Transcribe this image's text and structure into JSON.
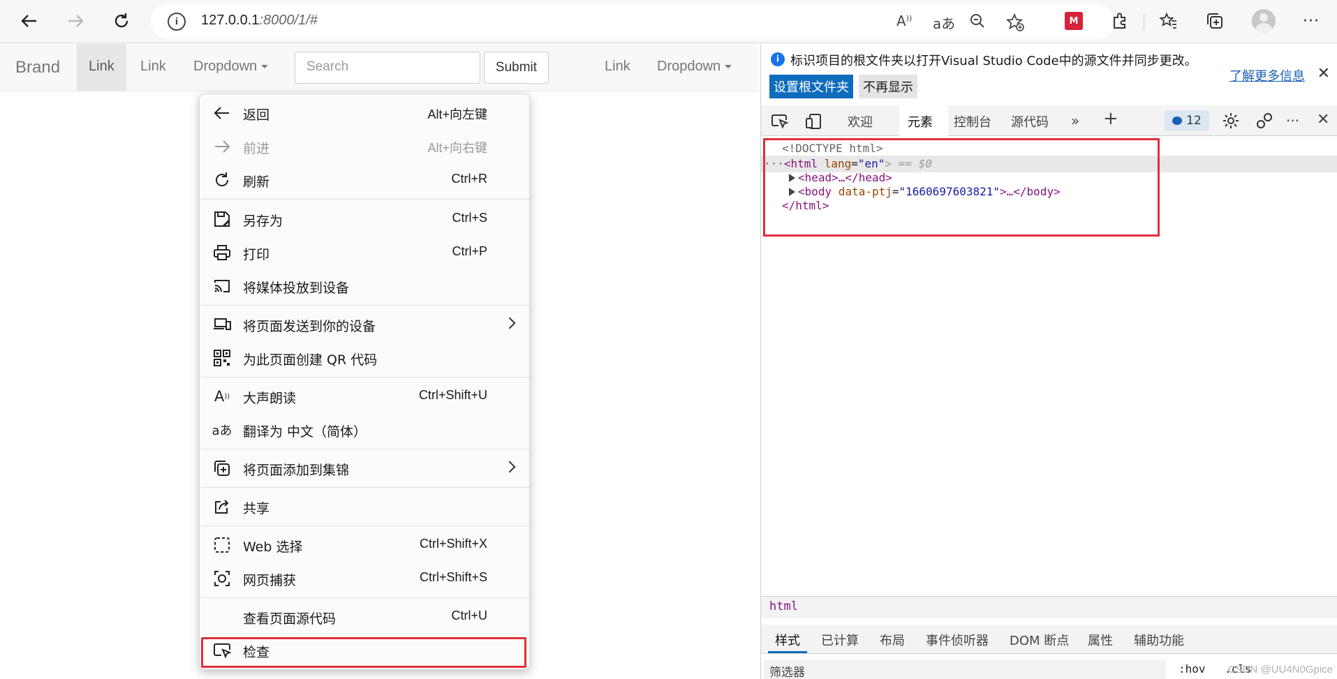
{
  "browser": {
    "url_host": "127.0.0.1",
    "url_rest": ":8000/1/#"
  },
  "navbar": {
    "brand": "Brand",
    "link_active": "Link",
    "link2": "Link",
    "dropdown": "Dropdown",
    "search_placeholder": "Search",
    "submit": "Submit",
    "link3": "Link",
    "dropdown2": "Dropdown"
  },
  "context_menu": {
    "items": [
      {
        "label": "返回",
        "shortcut": "Alt+向左键",
        "icon": "arrow-left-icon",
        "enabled": true
      },
      {
        "label": "前进",
        "shortcut": "Alt+向右键",
        "icon": "arrow-right-icon",
        "enabled": false
      },
      {
        "label": "刷新",
        "shortcut": "Ctrl+R",
        "icon": "refresh-icon",
        "enabled": true
      },
      {
        "label": "另存为",
        "shortcut": "Ctrl+S",
        "icon": "save-as-icon",
        "enabled": true
      },
      {
        "label": "打印",
        "shortcut": "Ctrl+P",
        "icon": "print-icon",
        "enabled": true
      },
      {
        "label": "将媒体投放到设备",
        "shortcut": "",
        "icon": "cast-icon",
        "enabled": true
      },
      {
        "label": "将页面发送到你的设备",
        "shortcut": "",
        "icon": "devices-icon",
        "enabled": true,
        "submenu": true
      },
      {
        "label": "为此页面创建 QR 代码",
        "shortcut": "",
        "icon": "qr-code-icon",
        "enabled": true
      },
      {
        "label": "大声朗读",
        "shortcut": "Ctrl+Shift+U",
        "icon": "read-aloud-icon",
        "enabled": true
      },
      {
        "label": "翻译为 中文（简体）",
        "shortcut": "",
        "icon": "translate-icon",
        "enabled": true
      },
      {
        "label": "将页面添加到集锦",
        "shortcut": "",
        "icon": "collections-icon",
        "enabled": true,
        "submenu": true
      },
      {
        "label": "共享",
        "shortcut": "",
        "icon": "share-icon",
        "enabled": true
      },
      {
        "label": "Web 选择",
        "shortcut": "Ctrl+Shift+X",
        "icon": "web-select-icon",
        "enabled": true
      },
      {
        "label": "网页捕获",
        "shortcut": "Ctrl+Shift+S",
        "icon": "capture-icon",
        "enabled": true
      },
      {
        "label": "查看页面源代码",
        "shortcut": "Ctrl+U",
        "icon": "",
        "enabled": true
      },
      {
        "label": "检查",
        "shortcut": "",
        "icon": "inspect-icon",
        "enabled": true
      }
    ]
  },
  "devtools": {
    "info_message": "标识项目的根文件夹以打开Visual Studio Code中的源文件并同步更改。",
    "learn_more": "了解更多信息",
    "btn_set_root": "设置根文件夹",
    "btn_dont_show": "不再显示",
    "tabs": [
      "欢迎",
      "元素",
      "控制台",
      "源代码"
    ],
    "message_count": "12",
    "dom": {
      "doctype": "<!DOCTYPE html>",
      "html_open_tag": "<html",
      "html_attr": "lang",
      "html_attr_val": "\"en\"",
      "html_suffix": "> == $0",
      "head": "<head>…</head>",
      "body_tag": "<body",
      "body_attr": "data-ptj",
      "body_attr_val": "\"1660697603821\"",
      "body_rest": ">…</body>",
      "html_close": "</html>"
    },
    "breadcrumb": "html",
    "sub_tabs": [
      "样式",
      "已计算",
      "布局",
      "事件侦听器",
      "DOM 断点",
      "属性",
      "辅助功能"
    ],
    "filter_label": "筛选器",
    "hov": ":hov",
    "cls": ".cls",
    "watermark": "CSDN @UU4N0Gpice"
  }
}
